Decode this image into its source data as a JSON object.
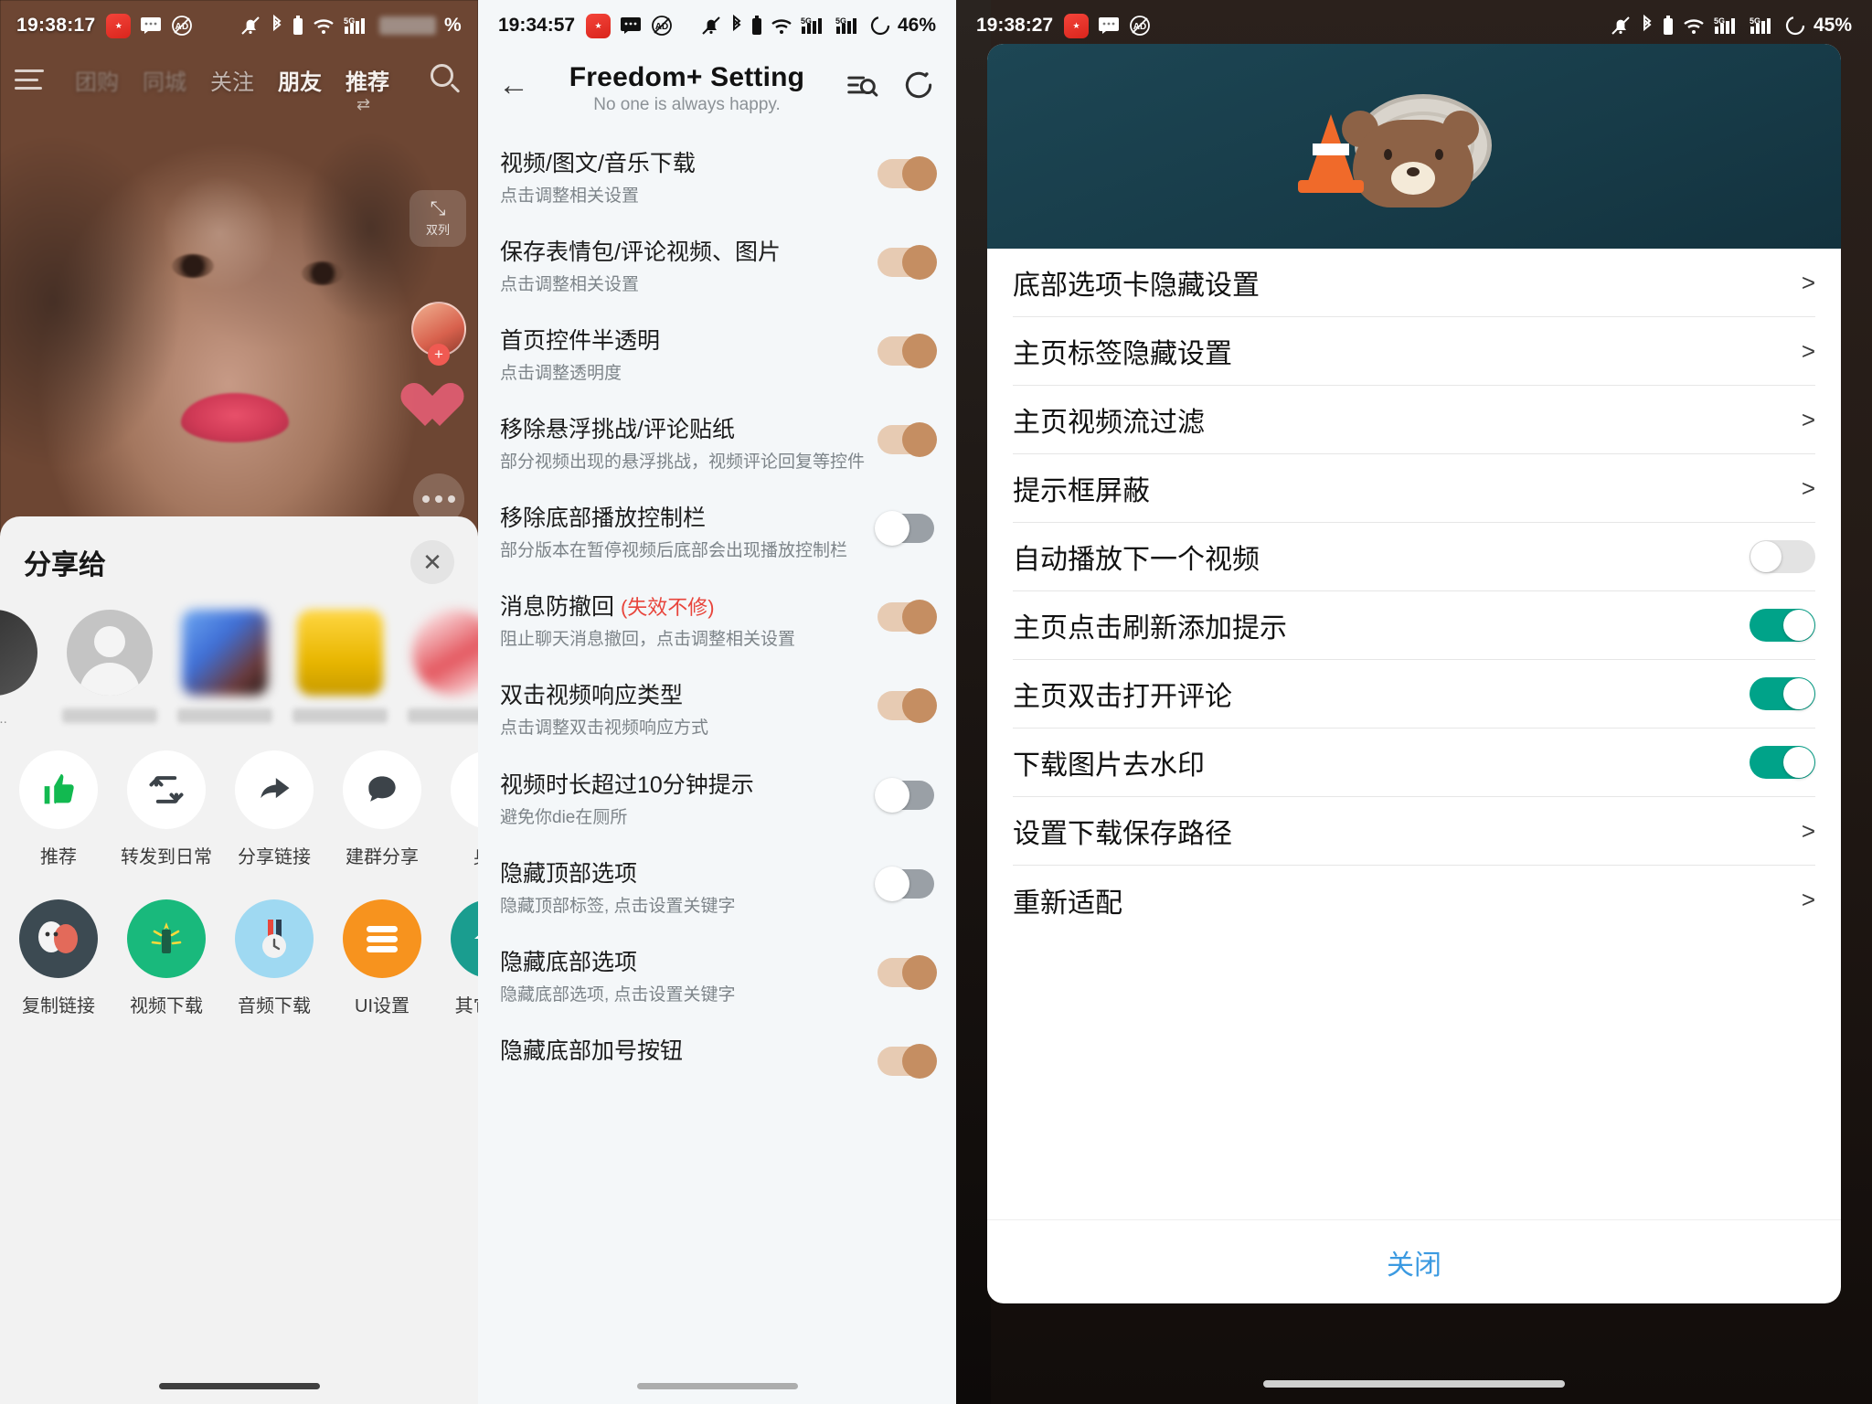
{
  "panel1": {
    "status": {
      "time": "19:38:17",
      "battery_percent_suffix": "%",
      "icons": [
        "app-badge-icon",
        "message-icon",
        "no-ad-icon",
        "bell-off-icon",
        "bluetooth-icon",
        "wifi-icon",
        "signal-5g-icon",
        "battery-icon"
      ]
    },
    "nav": {
      "menu_icon": "hamburger-icon",
      "tabs": [
        {
          "label": "团购",
          "state": "blurred"
        },
        {
          "label": "同城",
          "state": "blurred"
        },
        {
          "label": "关注",
          "state": "normal",
          "dot": true
        },
        {
          "label": "朋友",
          "state": "normal"
        },
        {
          "label": "推荐",
          "state": "active",
          "dot": true
        }
      ],
      "search_icon": "search-icon",
      "swap_icon": "swap-arrows-icon"
    },
    "overlay": {
      "double_column_chip": {
        "label": "双列",
        "icon": "collapse-arrows-icon"
      },
      "more_icon": "more-dots-icon",
      "like_icon": "heart-icon",
      "follow_plus": "+"
    },
    "share_sheet": {
      "title": "分享给",
      "close_icon": "close-icon",
      "contacts": [
        {
          "name": "元...",
          "avatar": "photo-dark"
        },
        {
          "name": "",
          "avatar": "generic-person"
        },
        {
          "name": "",
          "avatar": "photo-blue"
        },
        {
          "name": "",
          "avatar": "photo-yellow"
        },
        {
          "name": "",
          "avatar": "photo-red"
        },
        {
          "name": "",
          "avatar": "photo-partial"
        }
      ],
      "actions": [
        {
          "label": "推荐",
          "icon": "thumbs-up-icon"
        },
        {
          "label": "转发到日常",
          "icon": "repost-icon"
        },
        {
          "label": "分享链接",
          "icon": "share-arrow-icon"
        },
        {
          "label": "建群分享",
          "icon": "chat-bubble-icon"
        },
        {
          "label": "身...",
          "icon": "partial-icon"
        }
      ],
      "apps": [
        {
          "label": "复制链接",
          "icon": "masks-icon"
        },
        {
          "label": "视频下载",
          "icon": "sparkle-icon"
        },
        {
          "label": "音频下载",
          "icon": "clock-icon"
        },
        {
          "label": "UI设置",
          "icon": "lines-icon"
        },
        {
          "label": "其它设...",
          "icon": "home-icon"
        }
      ]
    }
  },
  "panel2": {
    "status": {
      "time": "19:34:57",
      "battery": "46%",
      "icons": [
        "app-badge-icon",
        "message-icon",
        "no-ad-icon",
        "bell-off-icon",
        "bluetooth-icon",
        "wifi-icon",
        "signal-5g-icon",
        "signal-5g-icon-2",
        "battery-icon"
      ]
    },
    "header": {
      "back_icon": "back-arrow-icon",
      "title": "Freedom+ Setting",
      "subtitle": "No one is always happy.",
      "search_icon": "list-search-icon",
      "refresh_icon": "refresh-circle-icon"
    },
    "items": [
      {
        "title": "视频/图文/音乐下载",
        "sub": "点击调整相关设置",
        "toggle": "on"
      },
      {
        "title": "保存表情包/评论视频、图片",
        "sub": "点击调整相关设置",
        "toggle": "on"
      },
      {
        "title": "首页控件半透明",
        "sub": "点击调整透明度",
        "toggle": "on"
      },
      {
        "title": "移除悬浮挑战/评论贴纸",
        "sub": "部分视频出现的悬浮挑战，视频评论回复等控件",
        "toggle": "on"
      },
      {
        "title": "移除底部播放控制栏",
        "sub": "部分版本在暂停视频后底部会出现播放控制栏",
        "toggle": "off"
      },
      {
        "title": "消息防撤回",
        "warn": "(失效不修)",
        "sub": "阻止聊天消息撤回，点击调整相关设置",
        "toggle": "on"
      },
      {
        "title": "双击视频响应类型",
        "sub": "点击调整双击视频响应方式",
        "toggle": "on"
      },
      {
        "title": "视频时长超过10分钟提示",
        "sub": "避免你die在厕所",
        "toggle": "off"
      },
      {
        "title": "隐藏顶部选项",
        "sub": "隐藏顶部标签, 点击设置关键字",
        "toggle": "off"
      },
      {
        "title": "隐藏底部选项",
        "sub": "隐藏底部选项, 点击设置关键字",
        "toggle": "on"
      },
      {
        "title": "隐藏底部加号按钮",
        "sub": "",
        "toggle": "on"
      }
    ]
  },
  "panel3": {
    "status": {
      "time": "19:38:27",
      "battery": "45%",
      "icons": [
        "app-badge-icon",
        "message-icon",
        "no-ad-icon",
        "bell-off-icon",
        "bluetooth-icon",
        "wifi-icon",
        "signal-5g-icon",
        "signal-5g-icon-2",
        "battery-icon"
      ]
    },
    "banner": {
      "illustration": "bear-in-manhole-with-traffic-cone"
    },
    "rows": [
      {
        "label": "底部选项卡隐藏设置",
        "control": "chevron",
        "chevron": ">"
      },
      {
        "label": "主页标签隐藏设置",
        "control": "chevron",
        "chevron": ">"
      },
      {
        "label": "主页视频流过滤",
        "control": "chevron",
        "chevron": ">"
      },
      {
        "label": "提示框屏蔽",
        "control": "chevron",
        "chevron": ">"
      },
      {
        "label": "自动播放下一个视频",
        "control": "toggle",
        "toggle": "off"
      },
      {
        "label": "主页点击刷新添加提示",
        "control": "toggle",
        "toggle": "on"
      },
      {
        "label": "主页双击打开评论",
        "control": "toggle",
        "toggle": "on"
      },
      {
        "label": "下载图片去水印",
        "control": "toggle",
        "toggle": "on"
      },
      {
        "label": "设置下载保存路径",
        "control": "chevron",
        "chevron": ">"
      },
      {
        "label": "重新适配",
        "control": "chevron",
        "chevron": ">"
      }
    ],
    "close_label": "关闭"
  },
  "colors": {
    "toggle_on_track": "#e7cbb3",
    "toggle_on_knob": "#c58e62",
    "toggle_off_track": "#9aa0a6",
    "teal_on": "#00a389",
    "link_blue": "#3b9ae1",
    "warn_red": "#e8453c",
    "banner_teal": "#1d4654"
  }
}
